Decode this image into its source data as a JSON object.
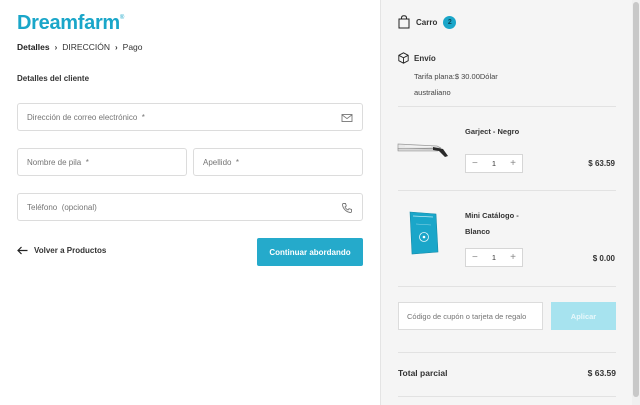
{
  "brand": {
    "name": "Dreamfarm",
    "mark": "®"
  },
  "breadcrumb": [
    {
      "label": "Detalles",
      "active": true
    },
    {
      "label": "DIRECCIÓN",
      "active": false
    },
    {
      "label": "Pago",
      "active": false
    }
  ],
  "form": {
    "section_title": "Detalles del cliente",
    "email_placeholder": "Dirección de correo electrónico  *",
    "first_name_placeholder": "Nombre de pila  *",
    "last_name_placeholder": "Apellido  *",
    "phone_placeholder": "Teléfono  (opcional)"
  },
  "actions": {
    "back_label": "Volver a Productos",
    "continue_label": "Continuar abordando"
  },
  "cart": {
    "title": "Carro",
    "count": "2",
    "shipping": {
      "title": "Envío",
      "description": "Tarifa plana:$ 30.00Dólar australiano"
    },
    "items": [
      {
        "name": "Garject - Negro",
        "quantity": "1",
        "price": "$ 63.59"
      },
      {
        "name": "Mini Catálogo - Blanco",
        "quantity": "1",
        "price": "$ 0.00"
      }
    ],
    "coupon_placeholder": "Código de cupón o tarjeta de regalo",
    "apply_label": "Aplicar",
    "subtotal_label": "Total parcial",
    "subtotal_value": "$ 63.59",
    "stepper_minus": "−",
    "stepper_plus": "+"
  },
  "colors": {
    "accent": "#1aa6c9",
    "accent_light": "#a7e3ef",
    "panel": "#f5f5f5"
  },
  "icons": [
    "mail-icon",
    "phone-icon",
    "arrow-left-icon",
    "bag-icon",
    "box-icon",
    "chevron-right-icon"
  ]
}
